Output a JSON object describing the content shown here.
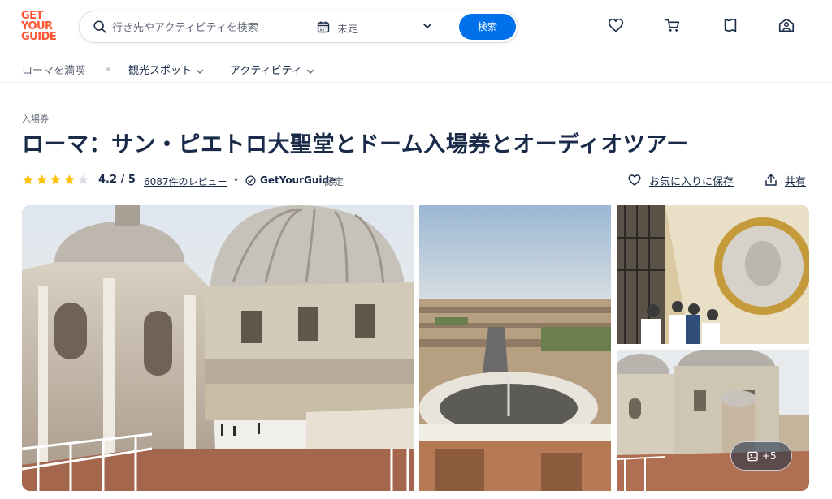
{
  "brand": {
    "logo_lines": [
      "GET",
      "YOUR",
      "GUIDE"
    ],
    "accent_color": "#ff5533",
    "primary_color": "#0071eb"
  },
  "search": {
    "placeholder": "行き先やアクティビティを検索",
    "date_label": "未定",
    "button_label": "検索",
    "icons": [
      "search-icon",
      "calendar-icon",
      "chevron-down-icon"
    ]
  },
  "header_icons": [
    "heart-icon",
    "cart-icon",
    "bookmark-icon",
    "profile-icon"
  ],
  "subnav": {
    "items": [
      {
        "label": "ローマを満喫"
      },
      {
        "label": "観光スポット"
      },
      {
        "label": "アクティビティ"
      }
    ]
  },
  "breadcrumb": "入場券",
  "title": "ローマ：サン・ピエトロ大聖堂とドーム入場券とオーディオツアー",
  "rating": {
    "stars_filled": 4,
    "stars_total": 5,
    "value_text": "4.2 / 5",
    "reviews_text": "6087件のレビュー",
    "separator": "•",
    "verified_brand": "GetYourGuide",
    "verified_text": "認定",
    "star_color": "#ffc107"
  },
  "actions": {
    "wishlist_label": "お気に入りに保存",
    "share_label": "共有"
  },
  "gallery": {
    "photos": [
      {
        "subject": "St. Peter's Basilica domes from the roof terrace"
      },
      {
        "subject": "Aerial view of St. Peter's Square and Rome"
      },
      {
        "subject": "Visitors inside the dome with mosaic medallion"
      },
      {
        "subject": "Dome terrace with visitors"
      }
    ],
    "more_label": "+5"
  }
}
